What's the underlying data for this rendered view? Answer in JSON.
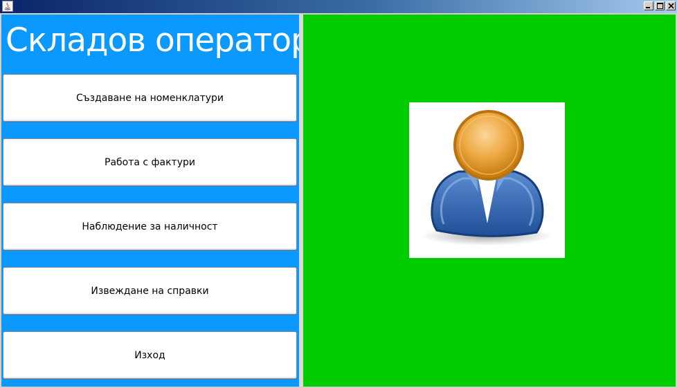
{
  "window": {
    "title": "",
    "controls": [
      "minimize",
      "maximize",
      "close"
    ]
  },
  "sidebar": {
    "heading": "Складов оператор",
    "buttons": [
      {
        "label": "Създаване на номенклатури"
      },
      {
        "label": "Работа с фактури"
      },
      {
        "label": "Наблюдение за наличност"
      },
      {
        "label": "Извеждане на справки"
      },
      {
        "label": "Изход"
      }
    ]
  },
  "main": {
    "image": "user-avatar-icon"
  },
  "colors": {
    "sidebar_bg": "#0b99ff",
    "main_bg": "#00cc00",
    "button_bg": "#ffffff"
  }
}
